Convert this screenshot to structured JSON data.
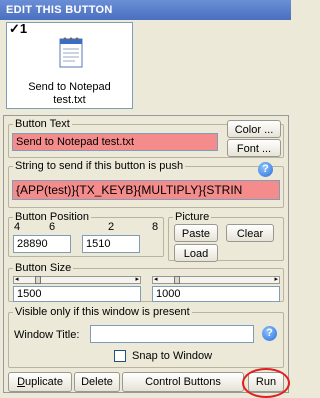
{
  "title": "EDIT THIS BUTTON",
  "preview": {
    "number": "1",
    "caption_line1": "Send to Notepad",
    "caption_line2": "test.txt",
    "icon": "notepad-icon",
    "checkmark": "✓"
  },
  "button_text": {
    "legend": "Button Text",
    "value": "Send to Notepad test.txt",
    "color_label": "Color ...",
    "font_label": "Font ..."
  },
  "string_send": {
    "legend": "String to send if this button is push",
    "value": "{APP(test)}{TX_KEYB}{MULTIPLY}{STRIN"
  },
  "position": {
    "legend": "Button Position",
    "t1": "4",
    "t2": "6",
    "t3": "2",
    "t4": "8",
    "x": "28890",
    "y": "1510"
  },
  "picture": {
    "legend": "Picture",
    "paste": "Paste",
    "clear": "Clear",
    "load": "Load"
  },
  "size": {
    "legend": "Button Size",
    "w": "1500",
    "h": "1000",
    "w_fraction": 0.1,
    "h_fraction": 0.1
  },
  "visible": {
    "legend": "Visible only if this window is present",
    "window_title_label": "Window Title:",
    "window_title_value": "",
    "snap_label": "Snap to Window"
  },
  "actions": {
    "duplicate": "Duplicate",
    "delete": "Delete",
    "control": "Control Buttons",
    "run": "Run"
  },
  "colors": {
    "error_field": "#f58c8c",
    "title_bar": "#4a6fc0",
    "highlight_ring": "#e02020"
  }
}
